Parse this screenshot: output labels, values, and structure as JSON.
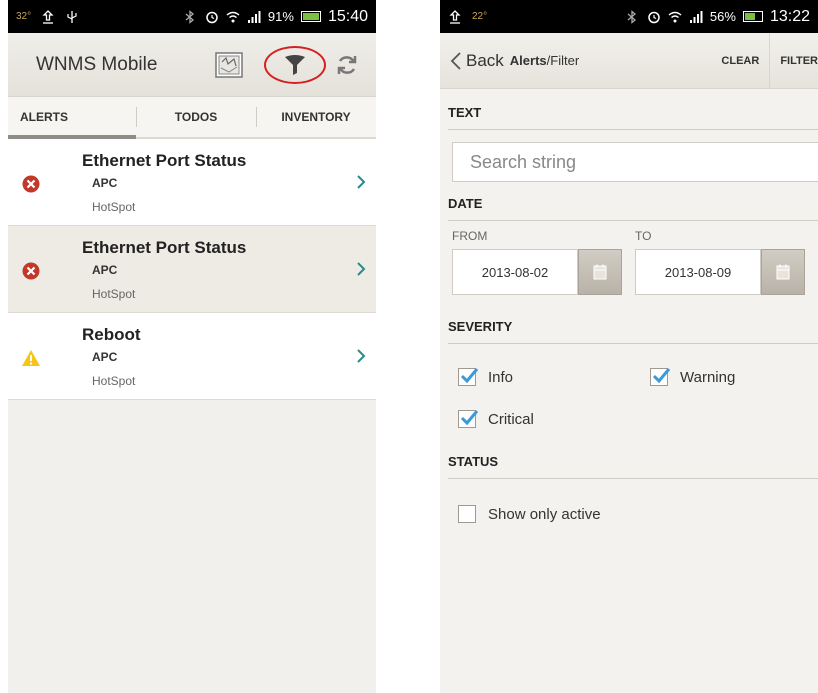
{
  "left": {
    "status": {
      "temp": "32°",
      "battery": "91%",
      "time": "15:40"
    },
    "app_title": "WNMS Mobile",
    "tabs": [
      "ALERTS",
      "TODOS",
      "INVENTORY"
    ],
    "alerts": [
      {
        "title": "Ethernet Port Status",
        "device": "APC",
        "location": "HotSpot",
        "severity": "critical"
      },
      {
        "title": "Ethernet Port Status",
        "device": "APC",
        "location": "HotSpot",
        "severity": "critical"
      },
      {
        "title": "Reboot",
        "device": "APC",
        "location": "HotSpot",
        "severity": "warning"
      }
    ],
    "icons": {
      "map": "map-icon",
      "filter": "filter-icon",
      "refresh": "refresh-icon"
    }
  },
  "right": {
    "status": {
      "temp": "22°",
      "battery": "56%",
      "time": "13:22"
    },
    "back_label": "Back",
    "breadcrumb_main": "Alerts",
    "breadcrumb_sub": "/Filter",
    "clear_label": "CLEAR",
    "filter_label": "FILTER",
    "text_section": "TEXT",
    "search_placeholder": "Search string",
    "date_section": "DATE",
    "from_label": "FROM",
    "to_label": "TO",
    "from_value": "2013-08-02",
    "to_value": "2013-08-09",
    "severity_section": "SEVERITY",
    "severity": {
      "info": "Info",
      "warning": "Warning",
      "critical": "Critical"
    },
    "status_section": "STATUS",
    "show_active_label": "Show only active"
  },
  "colors": {
    "critical": "#c0392b",
    "warning": "#f5c518",
    "check": "#3a9ad9",
    "highlight": "#d42020"
  }
}
